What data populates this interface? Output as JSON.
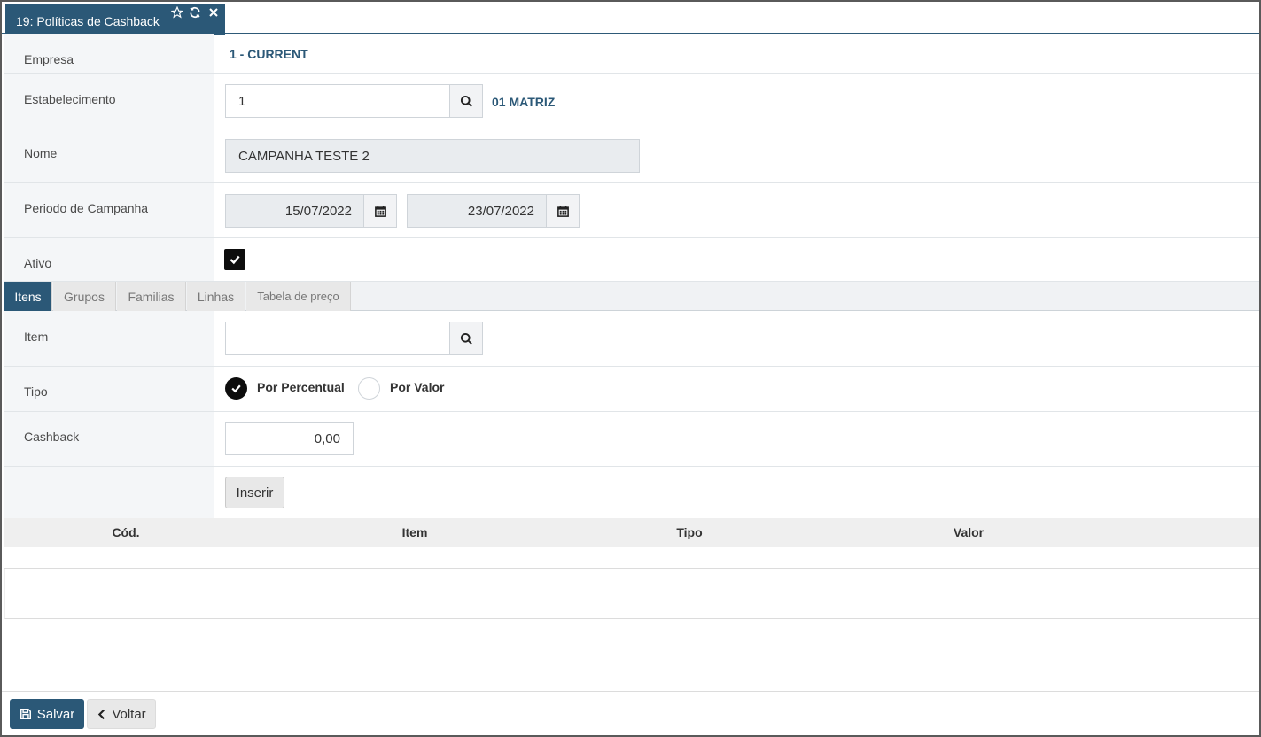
{
  "tab": {
    "title": "19: Políticas de Cashback",
    "star_icon": "star-icon",
    "refresh_icon": "refresh-icon",
    "close_icon": "close-icon"
  },
  "form": {
    "empresa": {
      "label": "Empresa",
      "value": "1 - CURRENT"
    },
    "estabelecimento": {
      "label": "Estabelecimento",
      "value": "1",
      "description": "01 MATRIZ"
    },
    "nome": {
      "label": "Nome",
      "value": "CAMPANHA TESTE 2"
    },
    "periodo": {
      "label": "Periodo de Campanha",
      "start": "15/07/2022",
      "end": "23/07/2022"
    },
    "ativo": {
      "label": "Ativo",
      "checked": true
    }
  },
  "subtabs": [
    {
      "label": "Itens",
      "active": true
    },
    {
      "label": "Grupos",
      "active": false
    },
    {
      "label": "Familias",
      "active": false
    },
    {
      "label": "Linhas",
      "active": false
    },
    {
      "label": "Tabela de preço",
      "active": false
    }
  ],
  "itens_form": {
    "item": {
      "label": "Item",
      "value": ""
    },
    "tipo": {
      "label": "Tipo",
      "options": [
        "Por Percentual",
        "Por Valor"
      ],
      "selected": "Por Percentual"
    },
    "cashback": {
      "label": "Cashback",
      "value": "0,00"
    },
    "insert_label": "Inserir"
  },
  "table": {
    "columns": [
      "Cód.",
      "Item",
      "Tipo",
      "Valor"
    ],
    "rows": []
  },
  "footer": {
    "save_label": "Salvar",
    "back_label": "Voltar"
  },
  "colors": {
    "primary": "#2b5877",
    "label_bg": "#f4f6f8"
  }
}
